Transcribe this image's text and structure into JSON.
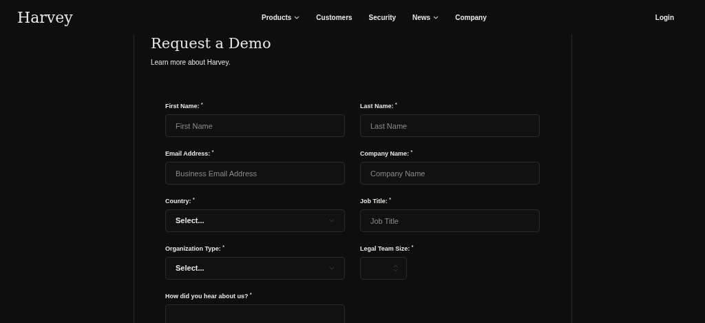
{
  "header": {
    "logo": "Harvey",
    "nav": [
      {
        "label": "Products",
        "dropdown": true
      },
      {
        "label": "Customers",
        "dropdown": false
      },
      {
        "label": "Security",
        "dropdown": false
      },
      {
        "label": "News",
        "dropdown": true
      },
      {
        "label": "Company",
        "dropdown": false
      }
    ],
    "login": "Login"
  },
  "form": {
    "title": "Request a Demo",
    "subtitle": "Learn more about Harvey.",
    "fields": [
      {
        "kind": "text",
        "label": "First Name: $^{*}$",
        "placeholder": "First Name"
      },
      {
        "kind": "text",
        "label": "Last Name: $^{*}$",
        "placeholder": "Last Name"
      },
      {
        "kind": "text",
        "label": "Email Address: $^{*}$",
        "placeholder": "Business Email Address"
      },
      {
        "kind": "text",
        "label": "Company Name: $^{*}$",
        "placeholder": "Company Name"
      },
      {
        "kind": "select",
        "label": "Country: $^{*}$",
        "value": "Select..."
      },
      {
        "kind": "text",
        "label": "Job Title: $^{*}$",
        "placeholder": "Job Title"
      },
      {
        "kind": "select",
        "label": "Organization Type: $^{*}$",
        "value": "Select..."
      },
      {
        "kind": "number",
        "label": "Legal Team Size: $^{*}$"
      },
      {
        "kind": "textarea",
        "label": "How did you hear about us? $^{*}$"
      }
    ]
  }
}
